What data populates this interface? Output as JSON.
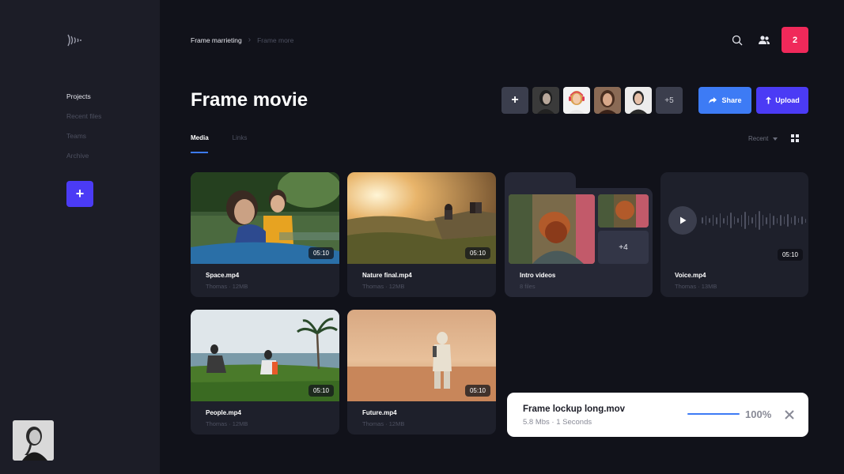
{
  "colors": {
    "accent_blue": "#3d7bf5",
    "accent_purple": "#4b3bf5",
    "badge_red": "#f0295a",
    "sidebar_bg": "#1c1d27",
    "page_bg": "#11121a"
  },
  "sidebar": {
    "logo_icon": "signal-waves-icon",
    "items": [
      {
        "label": "Projects",
        "active": true
      },
      {
        "label": "Recent files",
        "active": false
      },
      {
        "label": "Teams",
        "active": false
      },
      {
        "label": "Archive",
        "active": false
      }
    ],
    "add_label": "+"
  },
  "breadcrumb": {
    "items": [
      "Frame marrieting",
      "Frame more"
    ]
  },
  "header": {
    "notification_count": "2",
    "search_icon": "search-icon",
    "users_icon": "users-icon"
  },
  "page": {
    "title": "Frame movie"
  },
  "collaborators": {
    "add_label": "+",
    "more_label": "+5"
  },
  "actions": {
    "share_label": "Share",
    "upload_label": "Upload"
  },
  "tabs": [
    {
      "label": "Media",
      "active": true
    },
    {
      "label": "Links",
      "active": false
    }
  ],
  "sort": {
    "label": "Recent"
  },
  "media": [
    {
      "name": "Space.mp4",
      "meta": "Thomas · 12MB",
      "duration": "05:10"
    },
    {
      "name": "Nature final.mp4",
      "meta": "Thomas · 12MB",
      "duration": "05:10"
    },
    {
      "name": "Intro videos",
      "meta": "8 files",
      "more": "+4"
    },
    {
      "name": "Voice.mp4",
      "meta": "Thomas · 13MB",
      "duration": "05:10"
    },
    {
      "name": "People.mp4",
      "meta": "Thomas · 12MB",
      "duration": "05:10"
    },
    {
      "name": "Future.mp4",
      "meta": "Thomas · 12MB",
      "duration": "05:10"
    }
  ],
  "upload_status": {
    "filename": "Frame lockup long.mov",
    "info": "5.8 Mbs · 1 Seconds",
    "percent": "100%",
    "progress": 1.0
  }
}
